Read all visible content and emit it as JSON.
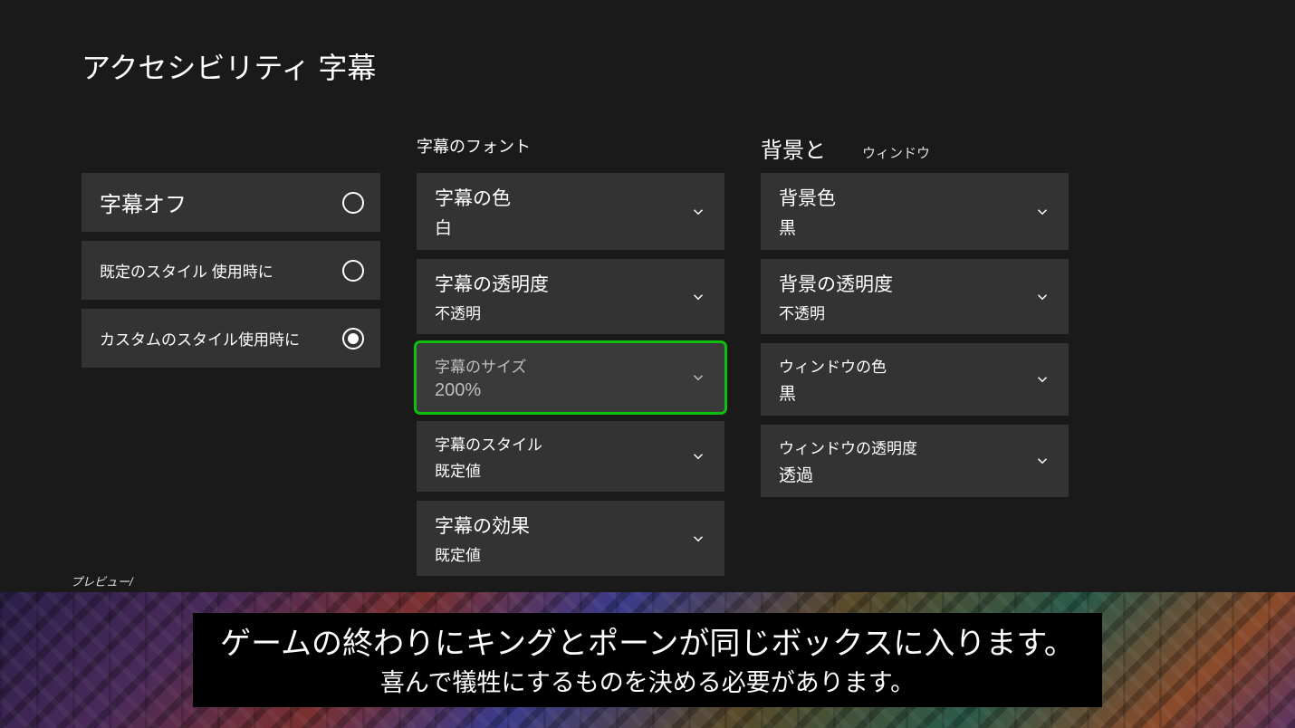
{
  "title": "アクセシビリティ 字幕",
  "left": {
    "options": [
      {
        "label": "字幕オフ",
        "selected": false,
        "large": true
      },
      {
        "label": "既定のスタイル 使用時に",
        "selected": false,
        "large": false
      },
      {
        "label": "カスタムのスタイル使用時に",
        "selected": true,
        "large": false
      }
    ]
  },
  "font_section": {
    "header": "字幕のフォント",
    "items": [
      {
        "label": "字幕の色",
        "value": "白",
        "focused": false
      },
      {
        "label": "字幕の透明度",
        "value": "不透明",
        "focused": false
      },
      {
        "label": "字幕のサイズ",
        "value": "200%",
        "focused": true
      },
      {
        "label": "字幕のスタイル",
        "value": "既定値",
        "focused": false,
        "small": true
      },
      {
        "label": "字幕の効果",
        "value": "既定値",
        "focused": false
      }
    ]
  },
  "bg_section": {
    "header_a": "背景と",
    "header_b": "ウィンドウ",
    "items": [
      {
        "label": "背景色",
        "value": "黒",
        "focused": false
      },
      {
        "label": "背景の透明度",
        "value": "不透明",
        "focused": false
      },
      {
        "label": "ウィンドウの色",
        "value": "黒",
        "focused": false,
        "small": true
      },
      {
        "label": "ウィンドウの透明度",
        "value": "透過",
        "focused": false,
        "mixed": true
      }
    ]
  },
  "preview": {
    "label": "プレビュー/",
    "line1": "ゲームの終わりにキングとポーンが同じボックスに入ります。",
    "line2": "喜んで犠牲にするものを決める必要があります。"
  }
}
